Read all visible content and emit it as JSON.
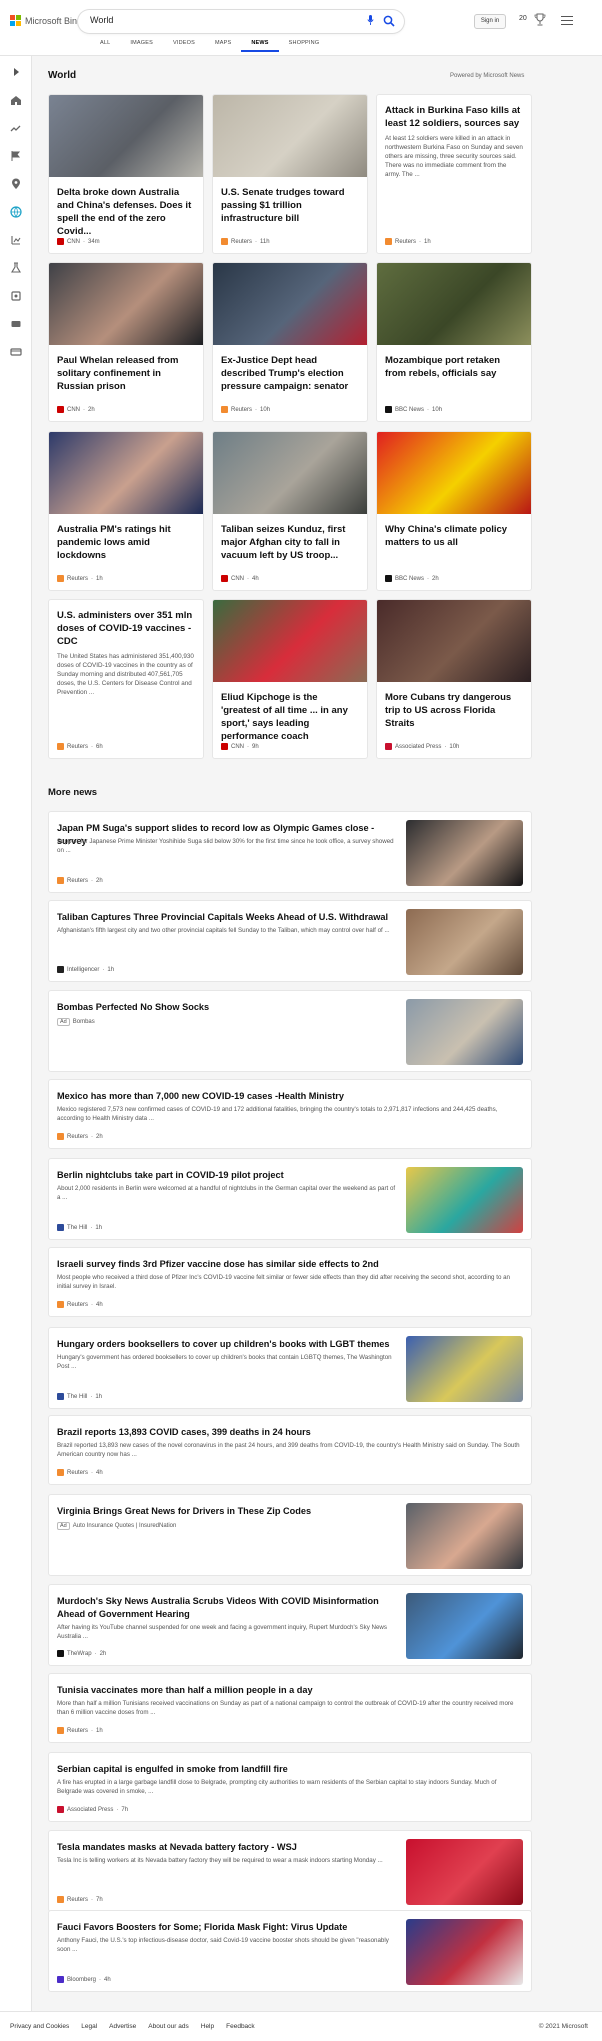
{
  "header": {
    "logo_text": "Microsoft Bing",
    "query": "World",
    "signin": "Sign in",
    "rewards": "20",
    "tabs": [
      "ALL",
      "IMAGES",
      "VIDEOS",
      "MAPS",
      "NEWS",
      "SHOPPING"
    ],
    "active_tab": "NEWS"
  },
  "section": {
    "title": "World",
    "powered": "Powered by Microsoft News"
  },
  "cards": [
    {
      "title": "Delta broke down Australia and China's defenses. Does it spell the end of the zero Covid...",
      "snippet": "",
      "source": "CNN",
      "time": "34m",
      "src_color": "#cc0000",
      "img": [
        "#7a8392",
        "#5b5f66",
        "#b8b6ae"
      ]
    },
    {
      "title": "U.S. Senate trudges toward passing $1 trillion infrastructure bill",
      "snippet": "",
      "source": "Reuters",
      "time": "11h",
      "src_color": "#f28b30",
      "img": [
        "#bcb6a8",
        "#d6d1c5",
        "#8f8a80"
      ]
    },
    {
      "title": "Attack in Burkina Faso kills at least 12 soldiers, sources say",
      "snippet": "At least 12 soldiers were killed in an attack in northwestern Burkina Faso on Sunday and seven others are missing, three security sources said. There was no immediate comment from the army. The ...",
      "source": "Reuters",
      "time": "1h",
      "src_color": "#f28b30",
      "img": null
    },
    {
      "title": "Paul Whelan released from solitary confinement in Russian prison",
      "snippet": "",
      "source": "CNN",
      "time": "2h",
      "src_color": "#cc0000",
      "img": [
        "#3f4147",
        "#b58f7c",
        "#1d1f23"
      ]
    },
    {
      "title": "Ex-Justice Dept head described Trump's election pressure campaign: senator",
      "snippet": "",
      "source": "Reuters",
      "time": "10h",
      "src_color": "#f28b30",
      "img": [
        "#2a3747",
        "#56657a",
        "#b32030"
      ]
    },
    {
      "title": "Mozambique port retaken from rebels, officials say",
      "snippet": "",
      "source": "BBC News",
      "time": "10h",
      "src_color": "#111111",
      "img": [
        "#5f6d3f",
        "#3b4727",
        "#8c8f5c"
      ]
    },
    {
      "title": "Australia PM's ratings hit pandemic lows amid lockdowns",
      "snippet": "",
      "source": "Reuters",
      "time": "1h",
      "src_color": "#f28b30",
      "img": [
        "#2d3a6a",
        "#c9a08e",
        "#1c2a55"
      ]
    },
    {
      "title": "Taliban seizes Kunduz, first major Afghan city to fall in vacuum left by US troop...",
      "snippet": "",
      "source": "CNN",
      "time": "4h",
      "src_color": "#cc0000",
      "img": [
        "#6e7e86",
        "#a9a49a",
        "#3c3f3c"
      ]
    },
    {
      "title": "Why China's climate policy matters to us all",
      "snippet": "",
      "source": "BBC News",
      "time": "2h",
      "src_color": "#111111",
      "img": [
        "#e02020",
        "#f5d000",
        "#b81515"
      ]
    },
    {
      "title": "U.S. administers over 351 mln doses of COVID-19 vaccines - CDC",
      "snippet": "The United States has administered 351,400,930 doses of COVID-19 vaccines in the country as of Sunday morning and distributed 407,561,705 doses, the U.S. Centers for Disease Control and Prevention ...",
      "source": "Reuters",
      "time": "6h",
      "src_color": "#f28b30",
      "img": null
    },
    {
      "title": "Eliud Kipchoge is the 'greatest of all time ... in any sport,' says leading performance coach",
      "snippet": "",
      "source": "CNN",
      "time": "9h",
      "src_color": "#cc0000",
      "img": [
        "#3a6b3f",
        "#d82d3b",
        "#8a6b55"
      ]
    },
    {
      "title": "More Cubans try dangerous trip to US across Florida Straits",
      "snippet": "",
      "source": "Associated Press",
      "time": "10h",
      "src_color": "#c8102e",
      "img": [
        "#4a2b2a",
        "#7b5a4a",
        "#2c2022"
      ]
    }
  ],
  "more": {
    "title": "More news",
    "items": [
      {
        "title": "Japan PM Suga's support slides to record low as Olympic Games close - survey",
        "snippet": "Support for Japanese Prime Minister Yoshihide Suga slid below 30% for the first time since he took office, a survey showed on ...",
        "source": "Reuters",
        "time": "2h",
        "ad": false,
        "src_color": "#f28b30",
        "img": [
          "#2c2d30",
          "#b89a84",
          "#121214"
        ]
      },
      {
        "title": "Taliban Captures Three Provincial Capitals Weeks Ahead of U.S. Withdrawal",
        "snippet": "Afghanistan's fifth largest city and two other provincial capitals fell Sunday to the Taliban, which may control over half of ...",
        "source": "Intelligencer",
        "time": "1h",
        "ad": false,
        "src_color": "#222222",
        "img": [
          "#8d6b52",
          "#c4a78a",
          "#5e4838"
        ]
      },
      {
        "title": "Bombas Perfected No Show Socks",
        "snippet": "",
        "source": "Bombas",
        "time": "",
        "ad": true,
        "src_color": "#ffffff",
        "img": [
          "#8b9aa8",
          "#c9c0b0",
          "#2f4a75"
        ]
      },
      {
        "title": "Mexico has more than 7,000 new COVID-19 cases -Health Ministry",
        "snippet": "Mexico registered 7,573 new confirmed cases of COVID-19 and 172 additional fatalities, bringing the country's totals to 2,971,817 infections and 244,425 deaths, according to Health Ministry data ...",
        "source": "Reuters",
        "time": "2h",
        "ad": false,
        "src_color": "#f28b30",
        "img": null
      },
      {
        "title": "Berlin nightclubs take part in COVID-19 pilot project",
        "snippet": "About 2,000 residents in Berlin were welcomed at a handful of nightclubs in the German capital over the weekend as part of a ...",
        "source": "The Hill",
        "time": "1h",
        "ad": false,
        "src_color": "#2d4b9a",
        "img": [
          "#e8c84a",
          "#2aa7a0",
          "#d14040"
        ]
      },
      {
        "title": "Israeli survey finds 3rd Pfizer vaccine dose has similar side effects to 2nd",
        "snippet": "Most people who received a third dose of Pfizer Inc's COVID-19 vaccine felt similar or fewer side effects than they did after receiving the second shot, according to an initial survey in Israel.",
        "source": "Reuters",
        "time": "4h",
        "ad": false,
        "src_color": "#f28b30",
        "img": null
      },
      {
        "title": "Hungary orders booksellers to cover up children's books with LGBT themes",
        "snippet": "Hungary's government has ordered booksellers to cover up children's books that contain LGBTQ themes, The Washington Post ...",
        "source": "The Hill",
        "time": "1h",
        "ad": false,
        "src_color": "#2d4b9a",
        "img": [
          "#3b5fb0",
          "#d8c85a",
          "#7a8aa0"
        ]
      },
      {
        "title": "Brazil reports 13,893 COVID cases, 399 deaths in 24 hours",
        "snippet": "Brazil reported 13,893 new cases of the novel coronavirus in the past 24 hours, and 399 deaths from COVID-19, the country's Health Ministry said on Sunday. The South American country now has ...",
        "source": "Reuters",
        "time": "4h",
        "ad": false,
        "src_color": "#f28b30",
        "img": null
      },
      {
        "title": "Virginia Brings Great News for Drivers in These Zip Codes",
        "snippet": "",
        "source": "Auto Insurance Quotes | InsuredNation",
        "time": "",
        "ad": true,
        "src_color": "#ffffff",
        "img": [
          "#5a6068",
          "#d8a890",
          "#30343a"
        ]
      },
      {
        "title": "Murdoch's Sky News Australia Scrubs Videos With COVID Misinformation Ahead of Government Hearing",
        "snippet": "After having its YouTube channel suspended for one week and facing a government inquiry, Rupert Murdoch's Sky News Australia ...",
        "source": "TheWrap",
        "time": "2h",
        "ad": false,
        "src_color": "#111111",
        "img": [
          "#3c5a7a",
          "#4f93d8",
          "#20262e"
        ]
      },
      {
        "title": "Tunisia vaccinates more than half a million people in a day",
        "snippet": "More than half a million Tunisians received vaccinations on Sunday as part of a national campaign to control the outbreak of COVID-19 after the country received more than 6 million vaccine doses from ...",
        "source": "Reuters",
        "time": "1h",
        "ad": false,
        "src_color": "#f28b30",
        "img": null
      },
      {
        "title": "Serbian capital is engulfed in smoke from landfill fire",
        "snippet": "A fire has erupted in a large garbage landfill close to Belgrade, prompting city authorities to warn residents of the Serbian capital to stay indoors Sunday. Much of Belgrade was covered in smoke, ...",
        "source": "Associated Press",
        "time": "7h",
        "ad": false,
        "src_color": "#c8102e",
        "img": null
      },
      {
        "title": "Tesla mandates masks at Nevada battery factory - WSJ",
        "snippet": "Tesla Inc is telling workers at its Nevada battery factory they will be required to wear a mask indoors starting Monday ...",
        "source": "Reuters",
        "time": "7h",
        "ad": false,
        "src_color": "#f28b30",
        "img": [
          "#c8102e",
          "#e04050",
          "#8a0a18"
        ]
      },
      {
        "title": "Fauci Favors Boosters for Some; Florida Mask Fight: Virus Update",
        "snippet": "Anthony Fauci, the U.S.'s top infectious-disease doctor, said Covid-19 vaccine booster shots should be given \"reasonably soon ...",
        "source": "Bloomberg",
        "time": "4h",
        "ad": false,
        "src_color": "#4b2cc8",
        "img": [
          "#2a3c8a",
          "#c23040",
          "#e8e8e8"
        ]
      }
    ]
  },
  "footer": {
    "links": [
      "Privacy and Cookies",
      "Legal",
      "Advertise",
      "About our ads",
      "Help",
      "Feedback"
    ],
    "copyright": "© 2021 Microsoft"
  },
  "colors": {
    "accent": "#174ae4",
    "logo": [
      "#f25022",
      "#7fba00",
      "#00a4ef",
      "#ffb900"
    ]
  }
}
